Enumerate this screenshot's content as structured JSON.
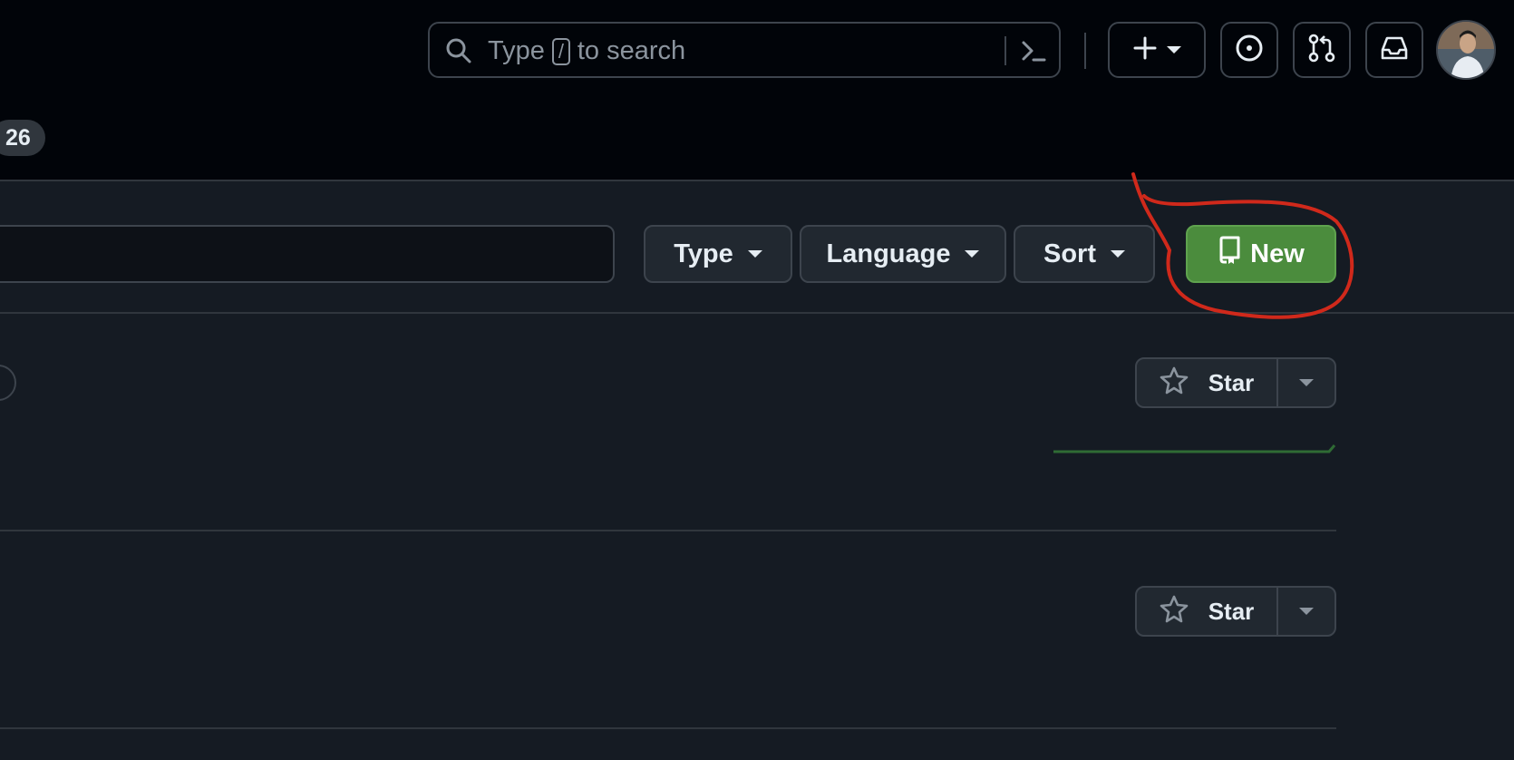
{
  "header": {
    "search": {
      "placeholder_prefix": "Type",
      "shortcut_key": "/",
      "placeholder_suffix": "to search"
    },
    "icons": [
      "search-icon",
      "command-palette-icon",
      "plus-icon",
      "issues-icon",
      "pull-requests-icon",
      "inbox-icon"
    ],
    "tab_count": "26"
  },
  "toolbar": {
    "type_label": "Type",
    "language_label": "Language",
    "sort_label": "Sort",
    "new_label": "New"
  },
  "repos": [
    {
      "star_label": "Star"
    },
    {
      "star_label": "Star"
    }
  ],
  "colors": {
    "accent_green": "#4b8c3d",
    "annotation_red": "#d0291b",
    "sparkline_green": "#2f6b34"
  }
}
